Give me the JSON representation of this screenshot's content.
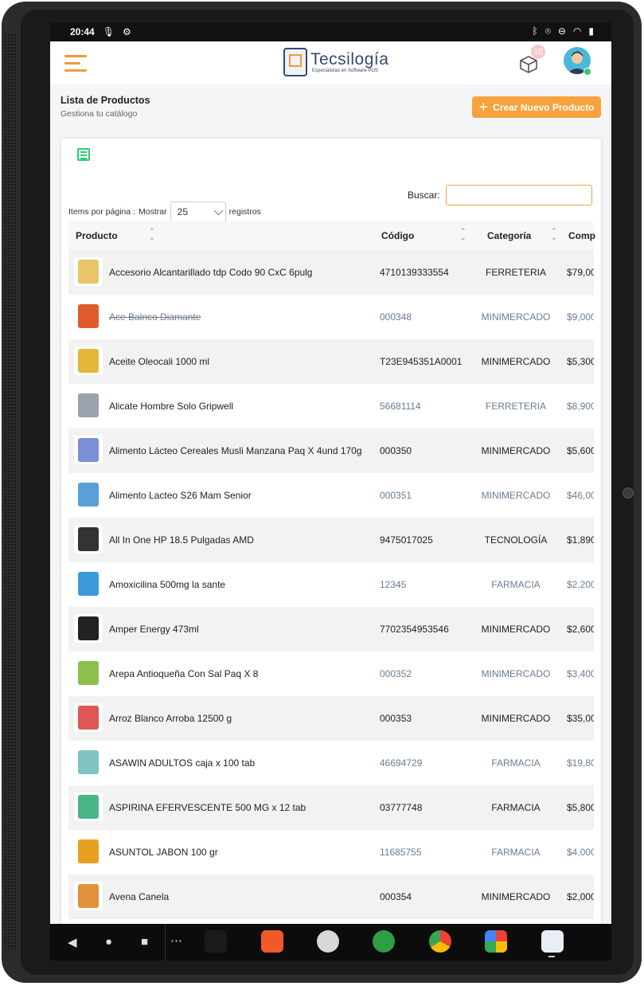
{
  "status_bar": {
    "time": "20:44"
  },
  "header": {
    "brand_title": "Tecsilogía",
    "brand_subtitle": "Especialistas en Software POS",
    "notifications_count": "10"
  },
  "page": {
    "title": "Lista de Productos",
    "subtitle": "Gestiona tu catálogo",
    "create_button_label": "Crear Nuevo Producto"
  },
  "table_controls": {
    "items_per_page_label": "Items por página :",
    "show_label": "Mostrar",
    "page_size": "25",
    "records_label": "registros",
    "search_label": "Buscar:",
    "search_value": ""
  },
  "table": {
    "columns": [
      "Producto",
      "Código",
      "Categoría",
      "Comp"
    ],
    "rows": [
      {
        "name": "Accesorio Alcantarillado tdp Codo 90 CxC 6pulg",
        "code": "4710139333554",
        "category": "FERRETERIA",
        "price": "$79,00",
        "thumb_color": "#e9c46a"
      },
      {
        "name": "Ace Balnco Diamante",
        "code": "000348",
        "category": "MINIMERCADO",
        "price": "$9,000",
        "thumb_color": "#e05a2b"
      },
      {
        "name": "Aceite Oleocali 1000 ml",
        "code": "T23E945351A0001",
        "category": "MINIMERCADO",
        "price": "$5,300",
        "thumb_color": "#e2b73a"
      },
      {
        "name": "Alicate Hombre Solo Gripwell",
        "code": "56681114",
        "category": "FERRETERIA",
        "price": "$8,900",
        "thumb_color": "#9aa3ad"
      },
      {
        "name": "Alimento Lácteo Cereales Musli Manzana Paq X 4und 170g",
        "code": "000350",
        "category": "MINIMERCADO",
        "price": "$5,600",
        "thumb_color": "#7b8fd6"
      },
      {
        "name": "Alimento Lacteo S26 Mam Senior",
        "code": "000351",
        "category": "MINIMERCADO",
        "price": "$46,00",
        "thumb_color": "#5aa0d8"
      },
      {
        "name": "All In One HP 18.5 Pulgadas AMD",
        "code": "9475017025",
        "category": "TECNOLOGÍA",
        "price": "$1,890",
        "thumb_color": "#333333"
      },
      {
        "name": "Amoxicilina 500mg la sante",
        "code": "12345",
        "category": "FARMACIA",
        "price": "$2,200",
        "thumb_color": "#3b9ad9"
      },
      {
        "name": "Amper Energy 473ml",
        "code": "7702354953546",
        "category": "MINIMERCADO",
        "price": "$2,600",
        "thumb_color": "#222222"
      },
      {
        "name": "Arepa Antioqueña Con Sal Paq X 8",
        "code": "000352",
        "category": "MINIMERCADO",
        "price": "$3,400",
        "thumb_color": "#8cc04b"
      },
      {
        "name": "Arroz Blanco Arroba 12500 g",
        "code": "000353",
        "category": "MINIMERCADO",
        "price": "$35,00",
        "thumb_color": "#e05555"
      },
      {
        "name": "ASAWIN ADULTOS caja x 100 tab",
        "code": "46694729",
        "category": "FARMACIA",
        "price": "$19,80",
        "thumb_color": "#7fc4c0"
      },
      {
        "name": "ASPIRINA EFERVESCENTE 500 MG x 12 tab",
        "code": "03777748",
        "category": "FARMACIA",
        "price": "$5,800",
        "thumb_color": "#4bb58a"
      },
      {
        "name": "ASUNTOL JABON 100 gr",
        "code": "11685755",
        "category": "FARMACIA",
        "price": "$4,000",
        "thumb_color": "#e8a020"
      },
      {
        "name": "Avena Canela",
        "code": "000354",
        "category": "MINIMERCADO",
        "price": "$2,000",
        "thumb_color": "#e2903a"
      }
    ]
  },
  "colors": {
    "accent": "#f7a23e",
    "brand": "#344a6e",
    "muted_text": "#6b7c93",
    "success": "#2ecc71"
  }
}
